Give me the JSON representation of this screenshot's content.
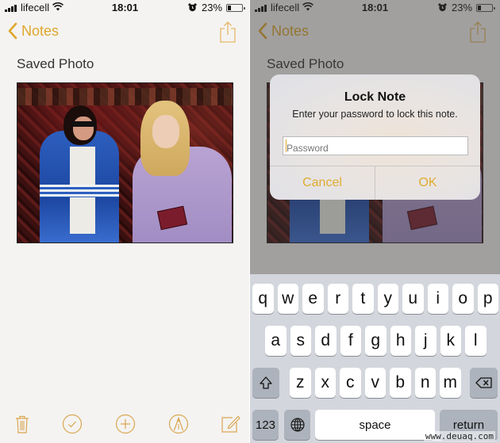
{
  "status_bar": {
    "carrier": "lifecell",
    "time": "18:01",
    "battery_percent": "23%",
    "battery_level": 0.23,
    "icons": [
      "signal-icon",
      "wifi-icon",
      "alarm-icon",
      "battery-icon"
    ]
  },
  "nav": {
    "back_label": "Notes",
    "share_icon": "share-icon"
  },
  "note": {
    "title": "Saved Photo",
    "image_description": "Photo of two women posing in front of a red patterned carpet"
  },
  "toolbar": {
    "items": [
      {
        "name": "delete",
        "icon": "trash-icon"
      },
      {
        "name": "checklist",
        "icon": "checkmark-circle-icon"
      },
      {
        "name": "add",
        "icon": "plus-circle-icon"
      },
      {
        "name": "sketch",
        "icon": "pen-tip-circle-icon"
      },
      {
        "name": "compose",
        "icon": "compose-icon"
      }
    ]
  },
  "alert": {
    "title": "Lock Note",
    "message": "Enter your password to lock this note.",
    "password_placeholder": "Password",
    "password_value": "",
    "cancel_label": "Cancel",
    "ok_label": "OK"
  },
  "keyboard": {
    "row1": [
      "q",
      "w",
      "e",
      "r",
      "t",
      "y",
      "u",
      "i",
      "o",
      "p"
    ],
    "row2": [
      "a",
      "s",
      "d",
      "f",
      "g",
      "h",
      "j",
      "k",
      "l"
    ],
    "row3": [
      "z",
      "x",
      "c",
      "v",
      "b",
      "n",
      "m"
    ],
    "shift_icon": "shift-icon",
    "delete_icon": "backspace-icon",
    "numbers_label": "123",
    "globe_icon": "globe-icon",
    "space_label": "space",
    "return_label": "return"
  },
  "colors": {
    "accent": "#dfa72e",
    "paper": "#f4f3f1",
    "keyboard_bg": "#d3d6dc",
    "fn_key": "#adb3bc"
  },
  "watermark": "www.deuaq.com"
}
